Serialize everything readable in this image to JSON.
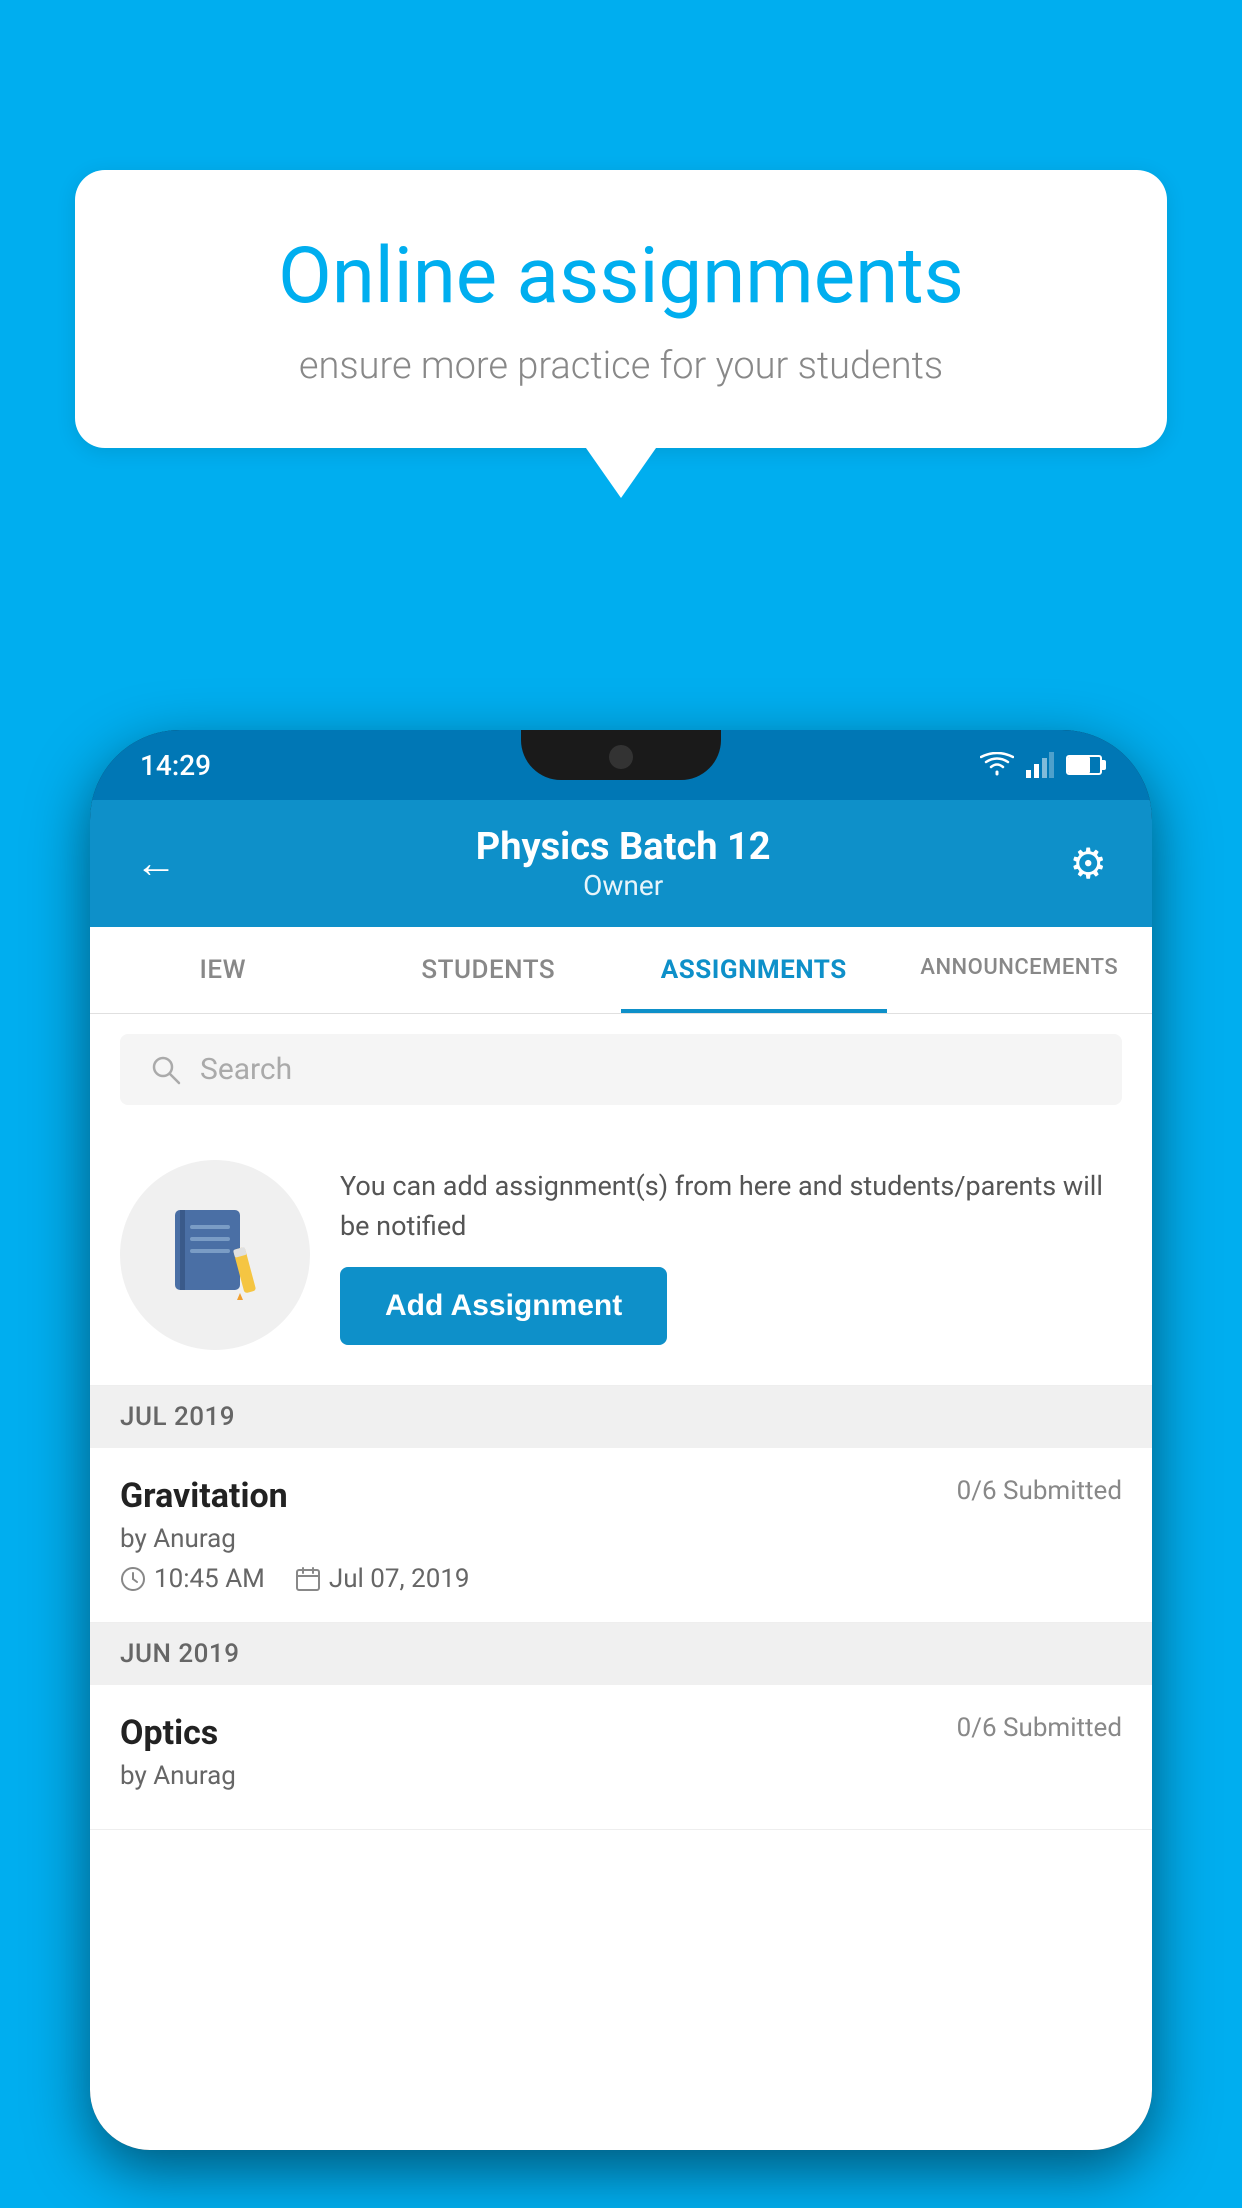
{
  "background": {
    "color": "#00AEEF"
  },
  "speech_bubble": {
    "title": "Online assignments",
    "subtitle": "ensure more practice for your students"
  },
  "phone": {
    "status_bar": {
      "time": "14:29"
    },
    "header": {
      "title": "Physics Batch 12",
      "subtitle": "Owner",
      "back_icon": "←",
      "settings_icon": "⚙"
    },
    "tabs": [
      {
        "label": "IEW",
        "active": false
      },
      {
        "label": "STUDENTS",
        "active": false
      },
      {
        "label": "ASSIGNMENTS",
        "active": true
      },
      {
        "label": "ANNOUNCEMENTS",
        "active": false
      }
    ],
    "search": {
      "placeholder": "Search"
    },
    "add_assignment": {
      "description": "You can add assignment(s) from here and students/parents will be notified",
      "button_label": "Add Assignment"
    },
    "assignment_groups": [
      {
        "month": "JUL 2019",
        "assignments": [
          {
            "name": "Gravitation",
            "submitted": "0/6 Submitted",
            "by": "by Anurag",
            "time": "10:45 AM",
            "date": "Jul 07, 2019"
          }
        ]
      },
      {
        "month": "JUN 2019",
        "assignments": [
          {
            "name": "Optics",
            "submitted": "0/6 Submitted",
            "by": "by Anurag",
            "time": "",
            "date": ""
          }
        ]
      }
    ]
  }
}
